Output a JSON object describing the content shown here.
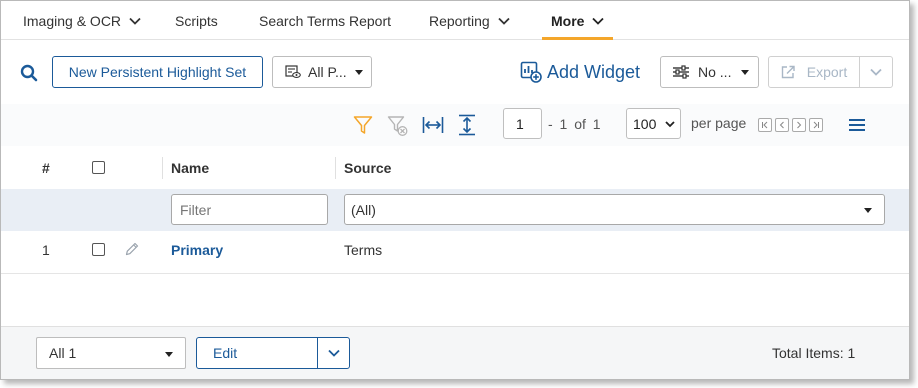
{
  "nav": {
    "tabs": [
      {
        "label": "Imaging & OCR",
        "has_dropdown": true
      },
      {
        "label": "Scripts",
        "has_dropdown": false
      },
      {
        "label": "Search Terms Report",
        "has_dropdown": false
      },
      {
        "label": "Reporting",
        "has_dropdown": true
      },
      {
        "label": "More",
        "has_dropdown": true,
        "active": true
      }
    ]
  },
  "toolbar": {
    "search_icon": "search-icon",
    "new_button": "New Persistent Highlight Set",
    "view_select": "All P...",
    "add_widget": "Add Widget",
    "no_select": "No ...",
    "export": "Export"
  },
  "pager": {
    "current_page": "1",
    "range_text": "- 1 of 1",
    "per_page_value": "100",
    "per_page_label": "per page"
  },
  "grid": {
    "columns": [
      "#",
      "",
      "Name",
      "Source"
    ],
    "filter": {
      "name_placeholder": "Filter",
      "source_value": "(All)"
    },
    "rows": [
      {
        "index": "1",
        "name": "Primary",
        "source": "Terms"
      }
    ]
  },
  "footer": {
    "selection": "All 1",
    "edit": "Edit",
    "total_items": "Total Items: 1"
  },
  "colors": {
    "accent": "#1b5a99",
    "tab_underline": "#f4a62a",
    "filter_icon": "#f4a62a",
    "filter_row_bg": "#e9eef5"
  }
}
